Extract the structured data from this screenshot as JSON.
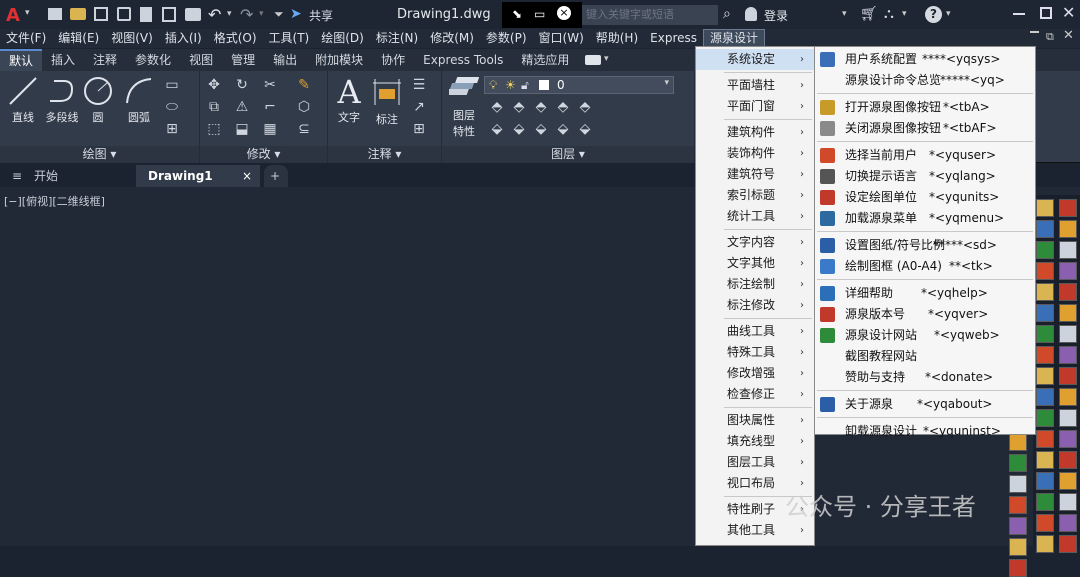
{
  "titlebar": {
    "file_name": "Drawing1.dwg",
    "share_label": "共享",
    "search_placeholder": "键入关键字或短语",
    "login_label": "登录",
    "help_label": "?"
  },
  "menubar": [
    "文件(F)",
    "编辑(E)",
    "视图(V)",
    "插入(I)",
    "格式(O)",
    "工具(T)",
    "绘图(D)",
    "标注(N)",
    "修改(M)",
    "参数(P)",
    "窗口(W)",
    "帮助(H)",
    "Express",
    "源泉设计"
  ],
  "ribbon_tabs": [
    "默认",
    "插入",
    "注释",
    "参数化",
    "视图",
    "管理",
    "输出",
    "附加模块",
    "协作",
    "Express Tools",
    "精选应用"
  ],
  "ribbon": {
    "draw": {
      "title": "绘图",
      "line": "直线",
      "polyline": "多段线",
      "circle": "圆",
      "arc": "圆弧"
    },
    "modify": {
      "title": "修改"
    },
    "annotation": {
      "title": "注释",
      "text": "文字",
      "dimension": "标注"
    },
    "layers": {
      "title": "图层",
      "props": "图层\n特性",
      "props1": "图层",
      "props2": "特性",
      "current_layer": "0"
    }
  },
  "doc_tabs": {
    "start": "开始",
    "drawing": "Drawing1",
    "close": "×",
    "add": "+"
  },
  "viewport_label": "[−][俯视][二维线框]",
  "menu_level1": [
    {
      "label": "系统设定",
      "group": 0
    },
    {
      "label": "平面墙柱",
      "group": 1
    },
    {
      "label": "平面门窗",
      "group": 1
    },
    {
      "label": "建筑构件",
      "group": 2
    },
    {
      "label": "装饰构件",
      "group": 2
    },
    {
      "label": "建筑符号",
      "group": 2
    },
    {
      "label": "索引标题",
      "group": 2
    },
    {
      "label": "统计工具",
      "group": 2
    },
    {
      "label": "文字内容",
      "group": 3
    },
    {
      "label": "文字其他",
      "group": 3
    },
    {
      "label": "标注绘制",
      "group": 3
    },
    {
      "label": "标注修改",
      "group": 3
    },
    {
      "label": "曲线工具",
      "group": 4
    },
    {
      "label": "特殊工具",
      "group": 4
    },
    {
      "label": "修改增强",
      "group": 4
    },
    {
      "label": "检查修正",
      "group": 4
    },
    {
      "label": "图块属性",
      "group": 5
    },
    {
      "label": "填充线型",
      "group": 5
    },
    {
      "label": "图层工具",
      "group": 5
    },
    {
      "label": "视口布局",
      "group": 5
    },
    {
      "label": "特性刷子",
      "group": 6
    },
    {
      "label": "其他工具",
      "group": 6
    }
  ],
  "menu_level2": [
    {
      "label": "用户系统配置",
      "cmd": "****<yqsys>",
      "icon": "config-icon",
      "color": "#3a6fb8"
    },
    {
      "label": "源泉设计命令总览",
      "cmd": "*****<yq>",
      "icon": "",
      "color": ""
    },
    {
      "label": "打开源泉图像按钮",
      "cmd": "*<tbA>",
      "icon": "toolbar-open-icon",
      "color": "#c89a2a"
    },
    {
      "label": "关闭源泉图像按钮",
      "cmd": "*<tbAF>",
      "icon": "toolbar-close-icon",
      "color": "#8a8a8a"
    },
    {
      "label": "选择当前用户",
      "cmd": "*<yquser>",
      "icon": "user-icon",
      "color": "#d04a2a"
    },
    {
      "label": "切换提示语言",
      "cmd": "*<yqlang>",
      "icon": "language-icon",
      "color": "#555555"
    },
    {
      "label": "设定绘图单位",
      "cmd": "*<yqunits>",
      "icon": "units-icon",
      "color": "#c0392b"
    },
    {
      "label": "加载源泉菜单",
      "cmd": "*<yqmenu>",
      "icon": "menu-load-icon",
      "color": "#2d6a9f"
    },
    {
      "label": "设置图纸/符号比例",
      "cmd": "*****<sd>",
      "icon": "scale-icon",
      "color": "#2a5fa8"
    },
    {
      "label": "绘制图框 (A0-A4)",
      "cmd": "**<tk>",
      "icon": "frame-icon",
      "color": "#3a7ac8"
    },
    {
      "label": "详细帮助",
      "cmd": "*<yqhelp>",
      "icon": "help-icon",
      "color": "#2a6fb8"
    },
    {
      "label": "源泉版本号",
      "cmd": "*<yqver>",
      "icon": "version-icon",
      "color": "#c0392b"
    },
    {
      "label": "源泉设计网站",
      "cmd": "*<yqweb>",
      "icon": "web-icon",
      "color": "#2e8b3a"
    },
    {
      "label": "截图教程网站",
      "cmd": "",
      "icon": "",
      "color": ""
    },
    {
      "label": "赞助与支持",
      "cmd": "*<donate>",
      "icon": "",
      "color": ""
    },
    {
      "label": "关于源泉",
      "cmd": "*<yqabout>",
      "icon": "about-icon",
      "color": "#2a5fa8"
    },
    {
      "label": "卸载源泉设计",
      "cmd": "*<yquninst>",
      "icon": "",
      "color": ""
    }
  ],
  "watermark": "公众号 · 分享王者",
  "colors": {
    "accent": "#5a8ad0",
    "menu_bg": "#f3f3f3",
    "highlight": "#cfe0f3",
    "canvas": "#212836"
  }
}
